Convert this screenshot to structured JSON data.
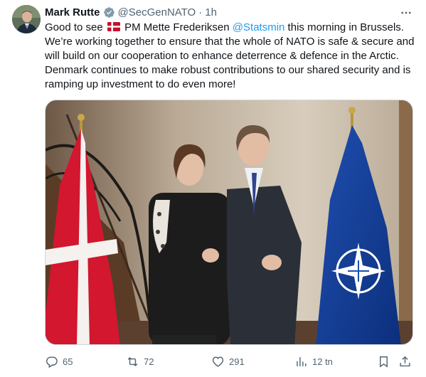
{
  "post": {
    "author": {
      "name": "Mark Rutte",
      "handle": "@SecGenNATO",
      "separator": "·",
      "time": "1h"
    },
    "text": {
      "part1": "Good to see ",
      "part2": " PM Mette Frederiksen ",
      "mention": "@Statsmin",
      "part3": " this morning in Brussels. We’re working together to ensure that the whole of NATO is safe & secure and will build on our cooperation to enhance deterrence & defence in the Arctic. Denmark continues to make robust contributions to our shared security and is ramping up investment to do even more!"
    },
    "actions": {
      "replies": "65",
      "reposts": "72",
      "likes": "291",
      "views": "12 tn"
    }
  },
  "colors": {
    "accent": "#1d9bf0",
    "secondary_text": "#536471",
    "border": "#cfd9de",
    "verified_badge": "#829aab"
  },
  "icons": [
    "verified-badge-icon",
    "more-options-icon",
    "reply-icon",
    "repost-icon",
    "like-icon",
    "views-icon",
    "bookmark-icon",
    "share-icon",
    "denmark-flag-emoji"
  ]
}
